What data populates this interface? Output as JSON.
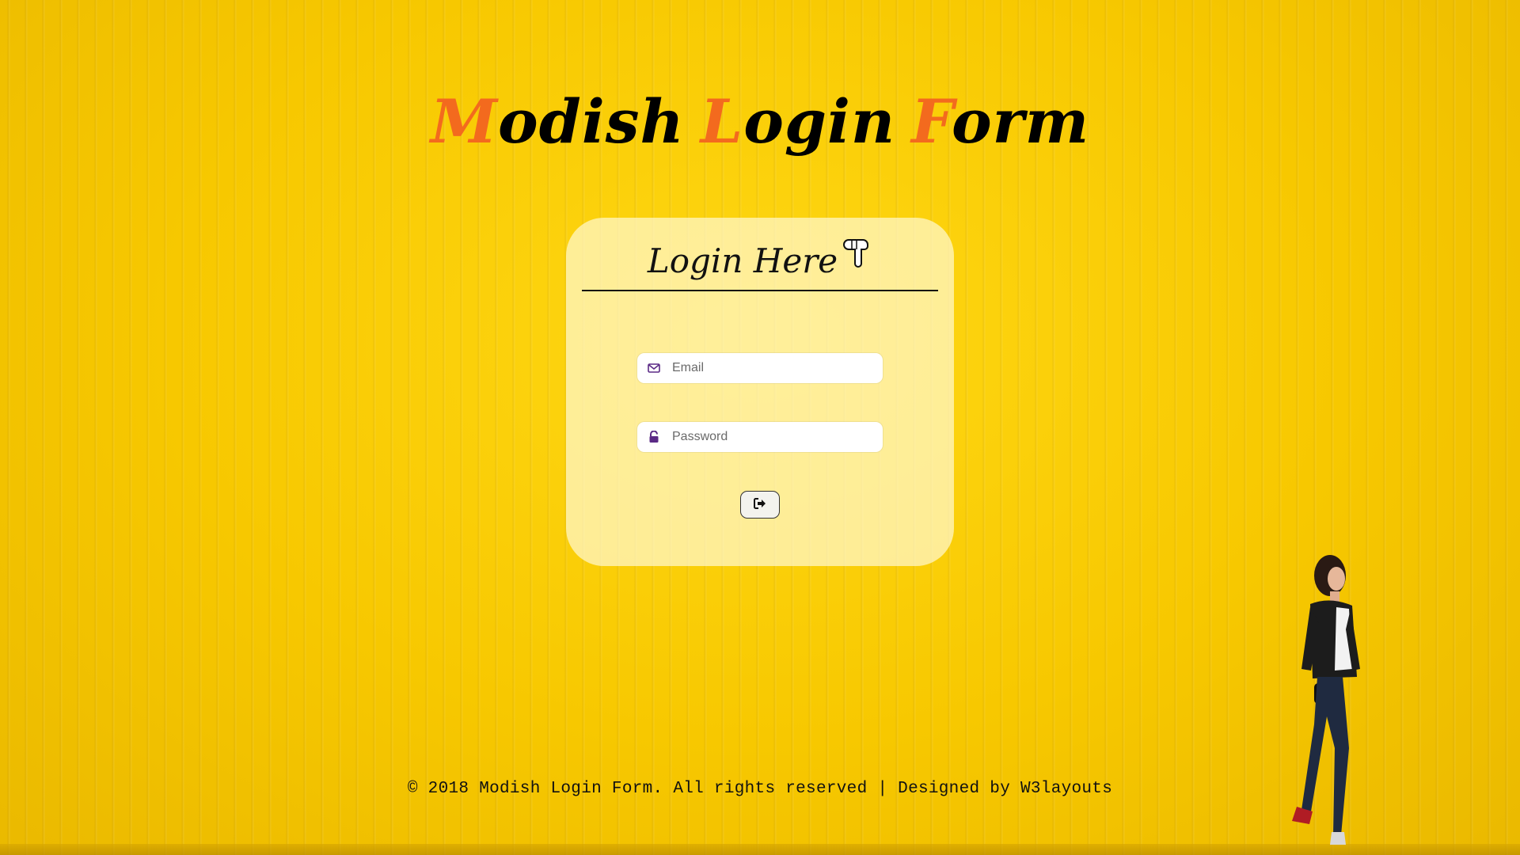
{
  "title": {
    "words": [
      {
        "cap": "M",
        "rest": "odish"
      },
      {
        "cap": "L",
        "rest": "ogin"
      },
      {
        "cap": "F",
        "rest": "orm"
      }
    ]
  },
  "card": {
    "heading": "Login Here",
    "heading_icon": "pointing-down-hand-icon"
  },
  "form": {
    "email": {
      "placeholder": "Email",
      "value": "",
      "icon": "envelope-icon"
    },
    "password": {
      "placeholder": "Password",
      "value": "",
      "icon": "unlock-icon"
    },
    "submit": {
      "icon": "sign-in-icon"
    }
  },
  "footer": {
    "text": "© 2018 Modish Login Form. All rights reserved | Designed by W3layouts"
  },
  "colors": {
    "background": "#f7c800",
    "accent": "#f36a1e",
    "icon": "#5b2a86"
  }
}
